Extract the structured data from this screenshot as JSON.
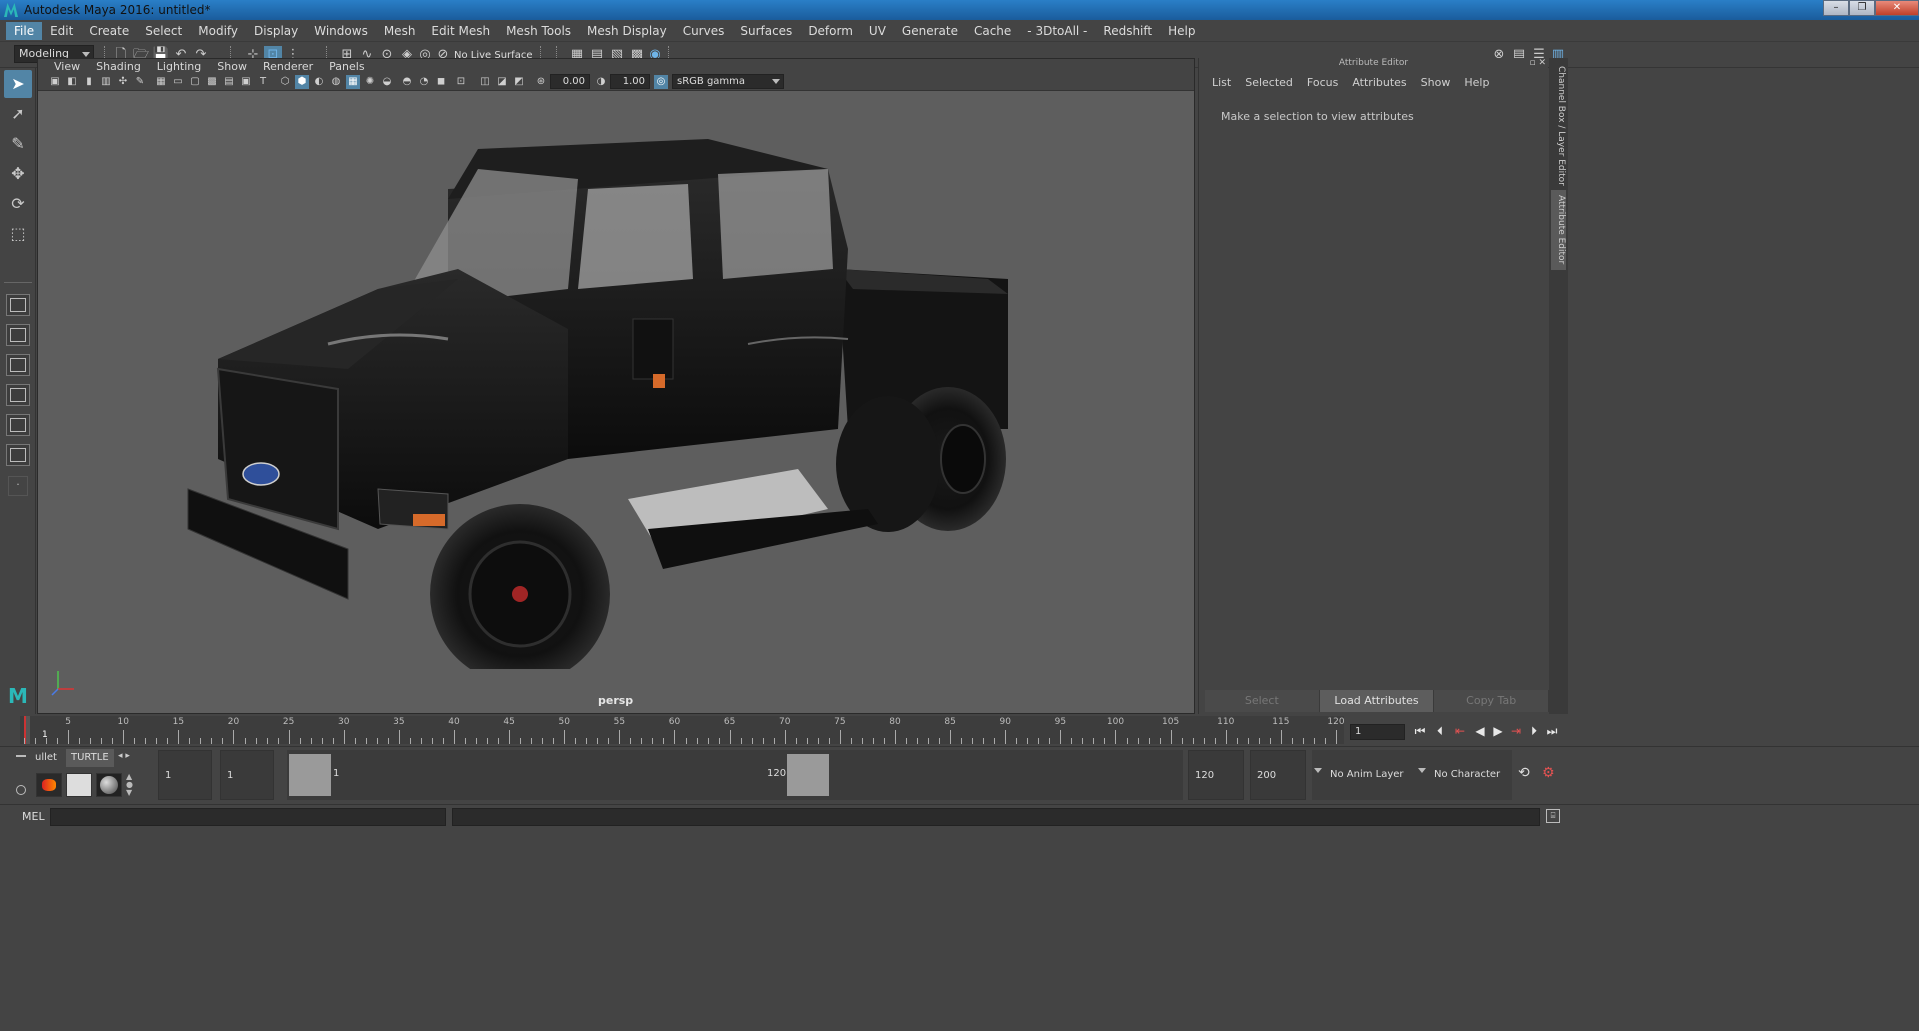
{
  "window": {
    "title": "Autodesk Maya 2016: untitled*",
    "controls": [
      "–",
      "❐",
      "✕"
    ]
  },
  "menubar": {
    "items": [
      "File",
      "Edit",
      "Create",
      "Select",
      "Modify",
      "Display",
      "Windows",
      "Mesh",
      "Edit Mesh",
      "Mesh Tools",
      "Mesh Display",
      "Curves",
      "Surfaces",
      "Deform",
      "UV",
      "Generate",
      "Cache",
      "- 3DtoAll -",
      "Redshift",
      "Help"
    ],
    "active_index": 0
  },
  "toolbar": {
    "mode": "Modeling",
    "live_surface": "No Live Surface"
  },
  "viewport": {
    "menu": [
      "View",
      "Shading",
      "Lighting",
      "Show",
      "Renderer",
      "Panels"
    ],
    "exposure": "0.00",
    "gamma": "1.00",
    "color_space": "sRGB gamma",
    "camera": "persp"
  },
  "attribute_editor": {
    "title": "Attribute Editor",
    "menu": [
      "List",
      "Selected",
      "Focus",
      "Attributes",
      "Show",
      "Help"
    ],
    "message": "Make a selection to view attributes",
    "buttons": [
      "Select",
      "Load Attributes",
      "Copy Tab"
    ]
  },
  "side_tabs": [
    "Channel Box / Layer Editor",
    "Attribute Editor"
  ],
  "timeline": {
    "ticks": [
      "5",
      "10",
      "15",
      "20",
      "25",
      "30",
      "35",
      "40",
      "45",
      "50",
      "55",
      "60",
      "65",
      "70",
      "75",
      "80",
      "85",
      "90",
      "95",
      "100",
      "105",
      "110",
      "115",
      "120"
    ],
    "current_frame_label": "1",
    "current_frame": "1",
    "range_start_frame": 1,
    "range_end_frame": 120
  },
  "shelf": {
    "tabs": [
      "ullet",
      "TURTLE"
    ]
  },
  "range": {
    "anim_start": "1",
    "playback_start": "1",
    "slider_start": "1",
    "slider_end": "120",
    "playback_end": "120",
    "anim_end": "200",
    "anim_layer": "No Anim Layer",
    "character_set": "No Character Set"
  },
  "command_line": {
    "label": "MEL"
  },
  "colors": {
    "accent": "#5285a6",
    "titlebar": "#1a5c9c",
    "viewport_bg": "#5e5e5e"
  }
}
